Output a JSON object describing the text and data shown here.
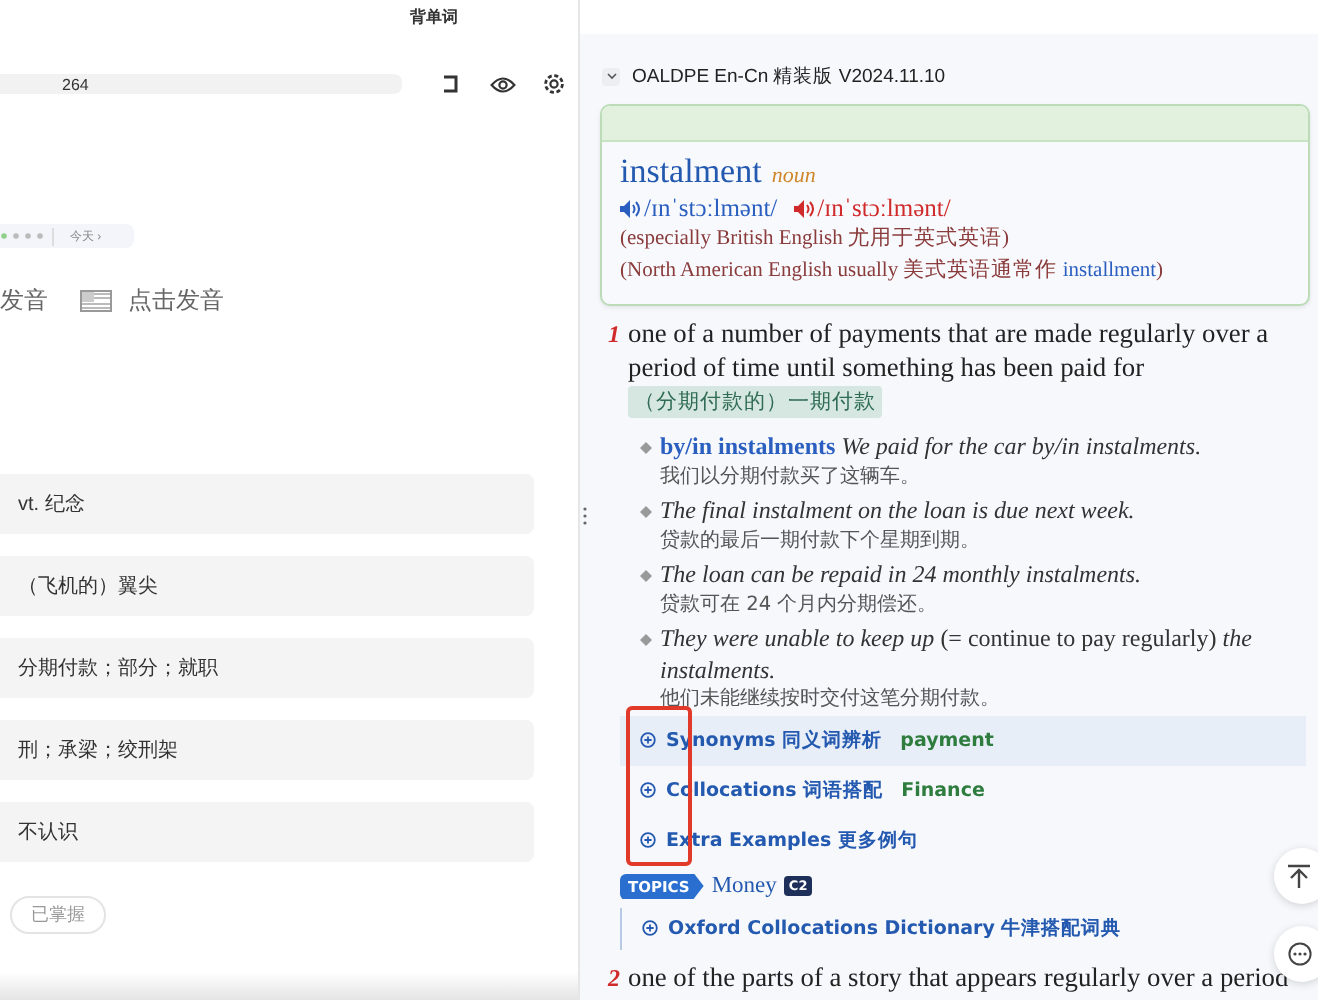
{
  "window": {
    "title": "背单词"
  },
  "study": {
    "progress": {
      "count": "264"
    },
    "review": {
      "date": "今天 ›"
    },
    "pronunciation": [
      {
        "label": "发音"
      },
      {
        "label": "点击发音"
      }
    ],
    "options": [
      {
        "text": "vt. 纪念"
      },
      {
        "text": "（飞机的）翼尖"
      },
      {
        "text": "分期付款；部分；就职"
      },
      {
        "text": "刑；承梁；绞刑架"
      },
      {
        "text": "不认识"
      }
    ],
    "mastered_button": "已掌握"
  },
  "dictionary": {
    "name": "OALDPE En-Cn 精装版 V2024.11.10",
    "expanded": true,
    "entry": {
      "headword": "instalment",
      "pos": "noun",
      "pronunciations": [
        {
          "kind": "br",
          "ipa": "/ɪnˈstɔːlmənt/"
        },
        {
          "kind": "us",
          "ipa": "/ɪnˈstɔːlmənt/"
        }
      ],
      "notes": [
        {
          "text": "(especially British English 尤用于英式英语)"
        },
        {
          "text": "(North American English usually 美式英语通常作 ",
          "link": "installment",
          "after": ")"
        }
      ]
    },
    "senses": [
      {
        "number": "1",
        "definition": "one of a number of payments that are made regularly over a period of time until something has been paid for",
        "translation": "（分期付款的）一期付款",
        "examples": [
          {
            "phrase": "by/in instalments",
            "sentence": "We paid for the car by/in instalments.",
            "translation": "我们以分期付款买了这辆车。"
          },
          {
            "sentence": "The final instalment on the loan is due next week.",
            "translation": "贷款的最后一期付款下个星期到期。"
          },
          {
            "sentence": "The loan can be repaid in 24 monthly instalments.",
            "translation": "贷款可在 24 个月内分期偿还。"
          },
          {
            "sentence": "They were unable to keep up",
            "gloss": "(= continue to pay regularly)",
            "sentence_end": "the instalments.",
            "translation": "他们未能继续按时交付这笔分期付款。"
          }
        ],
        "extras": [
          {
            "label": "Synonyms",
            "chinese": "同义词辨析",
            "tag": "payment",
            "highlighted": true
          },
          {
            "label": "Collocations",
            "chinese": "词语搭配",
            "tag": "Finance",
            "highlighted": false
          },
          {
            "label": "Extra Examples",
            "chinese": "更多例句",
            "highlighted": false
          }
        ],
        "topic": {
          "badge": "TOPICS",
          "name": "Money",
          "level": "C2"
        },
        "collocations_dictionary": "Oxford Collocations Dictionary 牛津搭配词典"
      },
      {
        "number": "2",
        "definition": "one of the parts of a story that appears regularly over a period"
      }
    ]
  }
}
